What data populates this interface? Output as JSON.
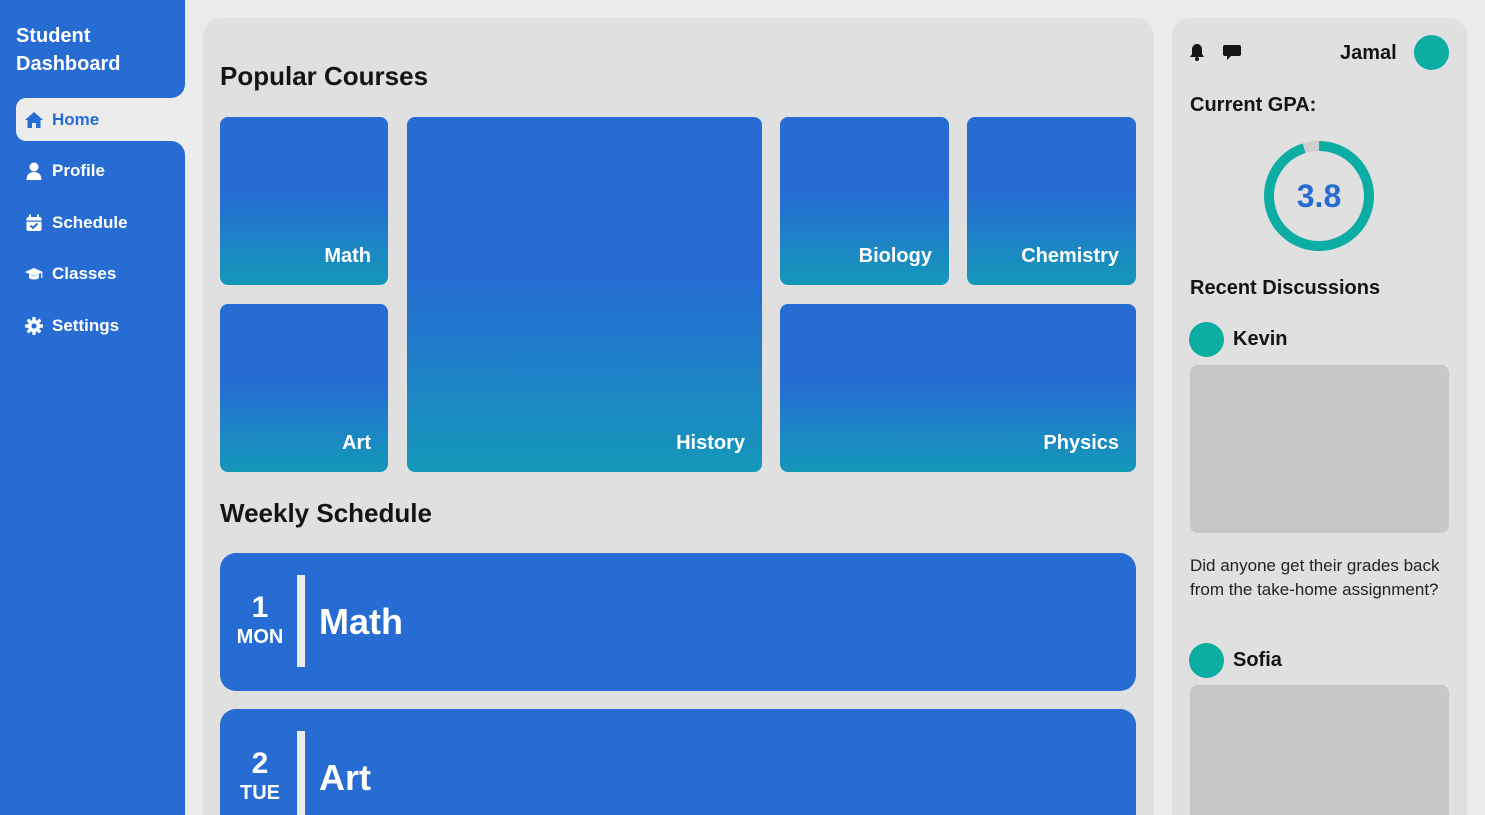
{
  "sidebar": {
    "brand": "Student Dashboard",
    "items": [
      {
        "label": "Home",
        "icon": "home-icon",
        "active": true
      },
      {
        "label": "Profile",
        "icon": "user-icon"
      },
      {
        "label": "Schedule",
        "icon": "calendar-check-icon"
      },
      {
        "label": "Classes",
        "icon": "graduation-cap-icon"
      },
      {
        "label": "Settings",
        "icon": "gear-icon"
      }
    ]
  },
  "main": {
    "popular_title": "Popular Courses",
    "courses": [
      "Math",
      "History",
      "Biology",
      "Chemistry",
      "Art",
      "Physics"
    ],
    "schedule_title": "Weekly Schedule",
    "schedule": [
      {
        "num": "1",
        "day": "MON",
        "course": "Math"
      },
      {
        "num": "2",
        "day": "TUE",
        "course": "Art"
      }
    ]
  },
  "right": {
    "username": "Jamal",
    "gpa_title": "Current GPA:",
    "gpa_value": "3.8",
    "gpa_fraction": 0.95,
    "discussions_title": "Recent Discussions",
    "posts": [
      {
        "author": "Kevin",
        "text": "Did anyone get their grades back from the take-home assignment?"
      },
      {
        "author": "Sofia",
        "text": ""
      }
    ]
  },
  "colors": {
    "primary": "#266cd3",
    "teal": "#0cada3",
    "panel": "#e0e0e0",
    "background": "#ebebeb"
  }
}
